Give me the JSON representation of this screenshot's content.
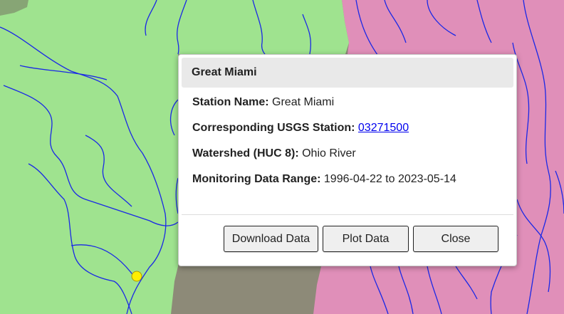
{
  "map": {
    "colors": {
      "green_watershed": "#9fe38f",
      "pink_watershed": "#e58fbd",
      "river": "#1a28e6",
      "station_marker": "#ffee00",
      "terrain": "#8d8a78"
    },
    "station_marker_icon": "station-marker-icon"
  },
  "popup": {
    "title": "Great Miami",
    "fields": [
      {
        "label": "Station Name:",
        "value": "Great Miami"
      },
      {
        "label": "Corresponding USGS Station:",
        "value": "03271500"
      },
      {
        "label": "Watershed (HUC 8):",
        "value": "Ohio River"
      },
      {
        "label": "Monitoring Data Range:",
        "value": "1996-04-22 to 2023-05-14"
      }
    ],
    "buttons": {
      "download": "Download Data",
      "plot": "Plot Data",
      "close": "Close"
    }
  }
}
